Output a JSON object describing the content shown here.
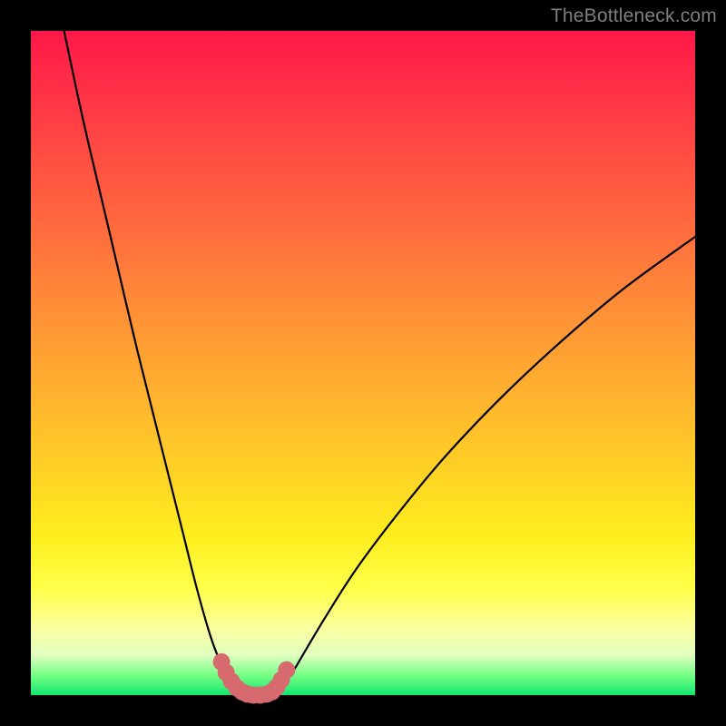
{
  "watermark": "TheBottleneck.com",
  "colors": {
    "background": "#000000",
    "curve_stroke": "#000000",
    "marker_fill": "#d76a6f",
    "marker_stroke": "#c85a60",
    "watermark_text": "#7f7f7f"
  },
  "chart_data": {
    "type": "line",
    "title": "",
    "xlabel": "",
    "ylabel": "",
    "xlim": [
      0,
      100
    ],
    "ylim": [
      0,
      100
    ],
    "grid": false,
    "legend": false,
    "series": [
      {
        "name": "left-curve",
        "x": [
          5,
          8,
          12,
          16,
          20,
          23,
          25,
          27,
          28.5,
          29.5,
          30.5,
          31.5,
          32.5
        ],
        "y": [
          100,
          86,
          69,
          52,
          36,
          24,
          16,
          9,
          5,
          3,
          1.5,
          0.6,
          0
        ]
      },
      {
        "name": "right-curve",
        "x": [
          37,
          38,
          39.5,
          41.5,
          44.5,
          49,
          55,
          62,
          70,
          79,
          89,
          100
        ],
        "y": [
          0,
          1.4,
          3.6,
          7,
          12,
          19,
          27,
          35.5,
          44,
          52.5,
          61,
          69
        ]
      },
      {
        "name": "trough-markers",
        "x": [
          28.7,
          29.4,
          30.2,
          31.0,
          31.8,
          32.6,
          33.5,
          34.5,
          35.5,
          36.3,
          37.0,
          37.7,
          38.5
        ],
        "y": [
          5.0,
          3.4,
          2.1,
          1.1,
          0.5,
          0.15,
          0.0,
          0.0,
          0.15,
          0.5,
          1.2,
          2.3,
          3.8
        ]
      }
    ],
    "annotations": []
  }
}
